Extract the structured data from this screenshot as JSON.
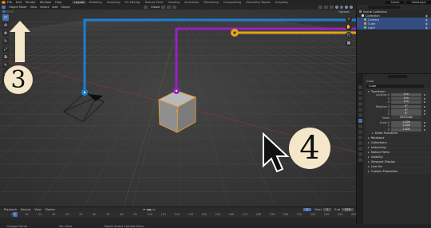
{
  "topbar": {
    "menus": [
      "File",
      "Edit",
      "Render",
      "Window",
      "Help"
    ],
    "workspaces": [
      "Layout",
      "Modeling",
      "Sculpting",
      "UV Editing",
      "Texture Paint",
      "Shading",
      "Animation",
      "Rendering",
      "Compositing",
      "Geometry Nodes",
      "Scripting"
    ],
    "active_workspace": "Layout",
    "scene": "Scene",
    "view_layer": "ViewLayer"
  },
  "viewport_header": {
    "mode": "Object Mode",
    "menus": [
      "View",
      "Select",
      "Add",
      "Object"
    ],
    "orientation": "Global",
    "sub_options": "Options"
  },
  "toolbar_icons": [
    "select-box-icon",
    "cursor-icon",
    "move-icon",
    "rotate-icon",
    "scale-icon",
    "transform-icon",
    "annotate-icon",
    "measure-icon",
    "add-cube-icon"
  ],
  "nav_icons": [
    "zoom-icon",
    "pan-icon",
    "camera-view-icon",
    "perspective-icon"
  ],
  "annotations": {
    "step_three": "3",
    "step_four": "4",
    "colors": {
      "blue": "#1a7fd4",
      "purple": "#9b1fc2",
      "yellow": "#e3a514",
      "badge": "#f4e7c9",
      "arrow": "#f4e7c9"
    }
  },
  "outliner": {
    "rows": [
      {
        "label": "Scene Collection",
        "color": "#8a8a8a",
        "selected": false
      },
      {
        "label": "Collection",
        "color": "#d4d4d4",
        "selected": false
      },
      {
        "label": "Camera",
        "color": "#6ec26e",
        "selected": true
      },
      {
        "label": "Cube",
        "color": "#e59b3a",
        "selected": true
      },
      {
        "label": "Light",
        "color": "#6ec26e",
        "selected": true
      }
    ]
  },
  "properties": {
    "object_name": "Cube",
    "breadcrumb": "Cube",
    "transform": {
      "title": "Transform",
      "location": [
        {
          "label": "Location X",
          "value": "0 m"
        },
        {
          "label": "Y",
          "value": "0 m"
        },
        {
          "label": "Z",
          "value": "0 m"
        }
      ],
      "rotation": [
        {
          "label": "Rotation X",
          "value": "0°"
        },
        {
          "label": "Y",
          "value": "0°"
        },
        {
          "label": "Z",
          "value": "0°"
        }
      ],
      "mode": {
        "label": "Mode",
        "value": "XYZ Euler"
      },
      "scale": [
        {
          "label": "Scale X",
          "value": "1.000"
        },
        {
          "label": "Y",
          "value": "1.000"
        },
        {
          "label": "Z",
          "value": "1.000"
        }
      ]
    },
    "subpanels": [
      "Delta Transform",
      "Relations",
      "Collections",
      "Instancing",
      "Motion Paths",
      "Visibility",
      "Viewport Display",
      "Line Art",
      "Custom Properties"
    ]
  },
  "timeline": {
    "menus": [
      "Playback",
      "Keying",
      "View",
      "Marker"
    ],
    "current_frame": "1",
    "start_label": "Start",
    "start": "1",
    "end_label": "End",
    "end": "250",
    "ticks": [
      "0",
      "10",
      "20",
      "30",
      "40",
      "50",
      "60",
      "70",
      "80",
      "90",
      "100",
      "110",
      "120",
      "130",
      "140",
      "150",
      "160",
      "170",
      "180",
      "190",
      "200",
      "210",
      "220",
      "230",
      "240",
      "250"
    ]
  },
  "statusbar": {
    "left": "Change Frame",
    "middle": "Pan View",
    "right": "Object Select Context Menu"
  }
}
